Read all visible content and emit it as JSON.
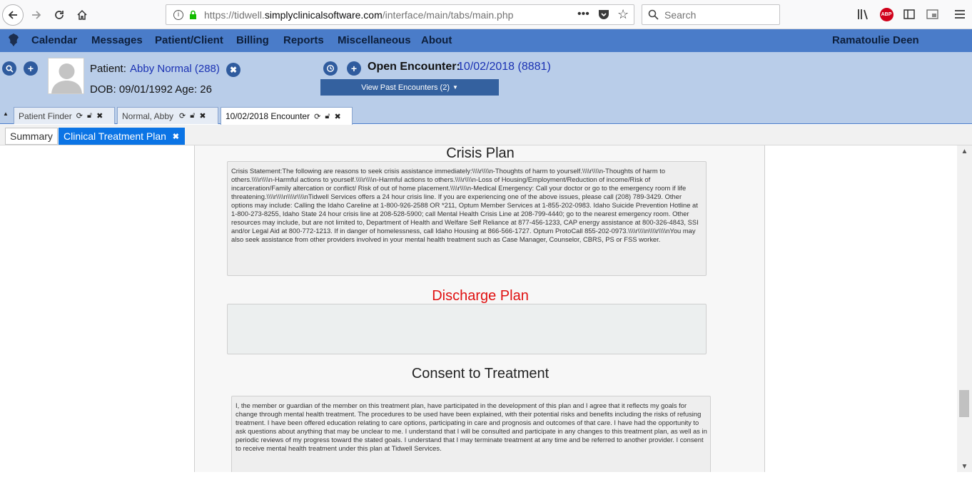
{
  "browser": {
    "url_prefix": "https://tidwell.",
    "url_domain": "simplyclinicalsoftware.com",
    "url_path": "/interface/main/tabs/main.php",
    "search_placeholder": "Search",
    "adblock_label": "ABP"
  },
  "menu": {
    "items": [
      "Calendar",
      "Messages",
      "Patient/Client",
      "Billing",
      "Reports",
      "Miscellaneous",
      "About"
    ],
    "user_name": "Ramatoulie Deen"
  },
  "patient": {
    "label": "Patient:",
    "name": "Abby Normal (288)",
    "dob_line": "DOB: 09/01/1992 Age: 26"
  },
  "encounter": {
    "label": "Open Encounter:",
    "value": "10/02/2018 (8881)",
    "past_button": "View Past Encounters  (2)"
  },
  "doc_tabs": [
    {
      "label": "Patient Finder"
    },
    {
      "label": "Normal, Abby"
    },
    {
      "label": "10/02/2018 Encounter"
    }
  ],
  "sub_tabs": {
    "summary": "Summary",
    "plan": "Clinical Treatment Plan"
  },
  "sections": {
    "crisis_title": "Crisis Plan",
    "crisis_text": "Crisis Statement:The following are reasons to seek crisis assistance immediately:\\\\\\\\r\\\\\\\\n-Thoughts of harm to yourself.\\\\\\\\r\\\\\\\\n-Thoughts of harm to others.\\\\\\\\r\\\\\\\\n-Harmful actions to yourself.\\\\\\\\r\\\\\\\\n-Harmful actions to others.\\\\\\\\r\\\\\\\\n-Loss of Housing/Employment/Reduction of income/Risk of incarceration/Family altercation or conflict/ Risk of out of home placement.\\\\\\\\r\\\\\\\\n-Medical Emergency: Call your doctor or go to the emergency room if life threatening.\\\\\\\\r\\\\\\\\n\\\\\\\\r\\\\\\\\nTidwell Services offers a 24 hour crisis line. If you are experiencing one of the above issues, please call (208) 789-3429. Other options may include: Calling the Idaho Careline at 1-800-926-2588 OR *211, Optum Member Services at 1-855-202-0983. Idaho Suicide Prevention Hotline at 1-800-273-8255, Idaho State 24 hour crisis line at 208-528-5900; call Mental Health Crisis Line at 208-799-4440; go to the nearest emergency room. Other resources may include, but are not limited to, Department of Health and Welfare Self Reliance at 877-456-1233, CAP energy assistance at 800-326-4843, SSI and/or Legal Aid at 800-772-1213. If in danger of homelessness, call Idaho Housing at 866-566-1727. Optum ProtoCall 855-202-0973.\\\\\\\\r\\\\\\\\n\\\\\\\\r\\\\\\\\nYou may also seek assistance from other providers involved in your mental health treatment such as Case Manager, Counselor, CBRS, PS or FSS worker.",
    "discharge_title": "Discharge Plan",
    "discharge_text": "",
    "consent_title": "Consent to Treatment",
    "consent_text": "I, the member or guardian of the member on this treatment plan, have participated in the development of this plan and I agree that it reflects my goals for change through mental health treatment. The procedures to be used have been explained, with their potential risks and benefits including the risks of refusing treatment. I have been offered education relating to care options, participating in care and prognosis and outcomes of that care. I have had the opportunity to ask questions about anything that may be unclear to me. I understand that I will be consulted and participate in any changes to this treatment plan, as well as in periodic reviews of my progress toward the stated goals. I understand that I may terminate treatment at any time and be referred to another provider. I consent to receive mental health treatment under this plan at Tidwell Services."
  },
  "colors": {
    "menubar": "#4a7cc9",
    "header_bg": "#b9cde9",
    "active_subtab": "#0b74e5",
    "discharge_title": "#e01010",
    "link": "#1a31b3"
  }
}
